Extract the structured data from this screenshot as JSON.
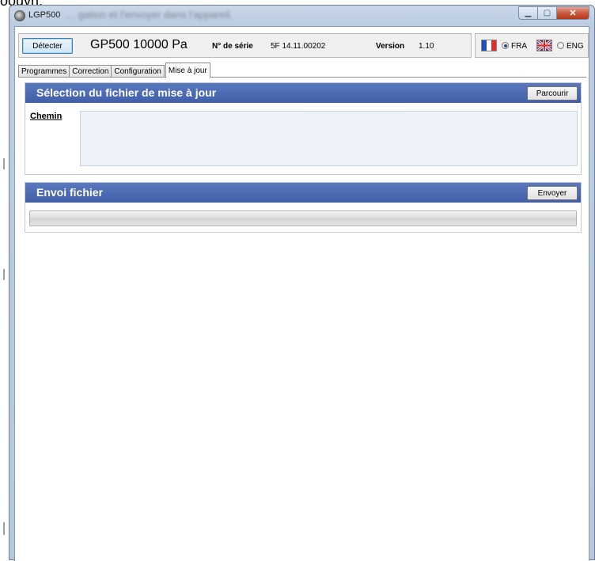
{
  "background_fragment": "oouvri.",
  "window": {
    "title": "LGP500",
    "blurred_title": "... gation et l'envoyer dans l'appareil."
  },
  "header": {
    "detect_button": "Détecter",
    "device_name": "GP500 10000 Pa",
    "serial_label": "N° de série",
    "serial_value": "5F 14.11.00202",
    "version_label": "Version",
    "version_value": "1.10"
  },
  "language": {
    "fr_label": "FRA",
    "en_label": "ENG",
    "selected": "FRA"
  },
  "tabs": [
    {
      "label": "Programmes"
    },
    {
      "label": "Correction"
    },
    {
      "label": "Configuration"
    },
    {
      "label": "Mise à jour"
    }
  ],
  "active_tab": "Mise à jour",
  "update_panel": {
    "title": "Sélection du fichier de mise à jour",
    "browse_button": "Parcourir",
    "path_label": "Chemin",
    "path_value": ""
  },
  "send_panel": {
    "title": "Envoi fichier",
    "send_button": "Envoyer",
    "progress": 0
  },
  "colors": {
    "panel_header": "#4767b0",
    "path_box": "#eef3fa",
    "window_frame": "#bccde2"
  }
}
